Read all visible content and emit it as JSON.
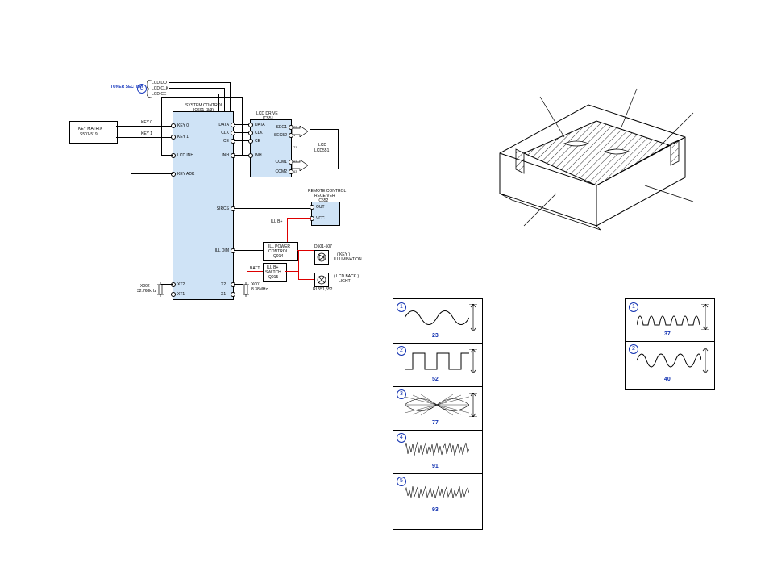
{
  "header": {
    "tuner_section": "TUNER SECTION",
    "tuner_badge": "C",
    "bus": {
      "lcd_do": "LCD DO",
      "lcd_clk": "LCD CLK",
      "lcd_ce": "LCD CE"
    }
  },
  "blocks": {
    "key_matrix": {
      "title1": "KEY MATRIX",
      "title2": "S501-519"
    },
    "system_control": {
      "title1": "SYSTEM CONTROL",
      "title2": "IC601 (3/3)"
    },
    "lcd_drive": {
      "title1": "LCD DRIVE",
      "title2": "IC551"
    },
    "lcd": {
      "title1": "LCD",
      "title2": "LCD551"
    },
    "remote": {
      "title1": "REMOTE CONTROL",
      "title2": "RECEIVER",
      "title3": "IC552"
    },
    "ill_power": {
      "title1": "ILL POWER",
      "title2": "CONTROL",
      "title3": "Q914"
    },
    "ill_switch": {
      "title1": "ILL B+",
      "title2": "SWITCH",
      "title3": "Q915"
    },
    "key_illum": {
      "label1": "D501-507",
      "label2": "KEY",
      "label3": "ILLUMINATION"
    },
    "back_light": {
      "label1": "RL551,552",
      "label2": "LCD BACK",
      "label3": "LIGHT"
    }
  },
  "pins": {
    "sc_left": {
      "key0": "KEY 0",
      "key1": "KEY 1",
      "lcd_inh": "LCD INH",
      "key_adk": "KEY ADK",
      "xt2": "XT2",
      "xt1": "XT1"
    },
    "sc_right": {
      "data": "DATA",
      "clk": "CLK",
      "ce": "CE",
      "inh": "INH",
      "sircs": "SIRCS",
      "ill_dim": "ILL DIM",
      "x2": "X2",
      "x1": "X1"
    },
    "key_bus": {
      "key0": "KEY 0",
      "key1": "KEY 1"
    },
    "lcd_drive_right": {
      "seg1": "SEG1",
      "seg52": "SEG52",
      "com1": "COM1",
      "com2": "COM2"
    },
    "lcd_drive_right_nums": {
      "a": "23",
      "b": "1",
      "c": "71",
      "d": "67",
      "e": "63"
    },
    "remote_right": {
      "out": "OUT",
      "vcc": "VCC"
    },
    "misc": {
      "ill_bplus": "ILL B+",
      "batt": "BATT"
    }
  },
  "crystals": {
    "x002": {
      "name": "X002",
      "val": "32.768kHz"
    },
    "x001": {
      "name": "X001",
      "val": "8.38MHz"
    }
  },
  "waveforms": {
    "left": [
      {
        "idx": "1",
        "val": "23"
      },
      {
        "idx": "2",
        "val": "52"
      },
      {
        "idx": "3",
        "val": "77"
      },
      {
        "idx": "4",
        "val": "91"
      },
      {
        "idx": "5",
        "val": "93"
      }
    ],
    "right": [
      {
        "idx": "1",
        "val": "37"
      },
      {
        "idx": "2",
        "val": "40"
      }
    ]
  }
}
